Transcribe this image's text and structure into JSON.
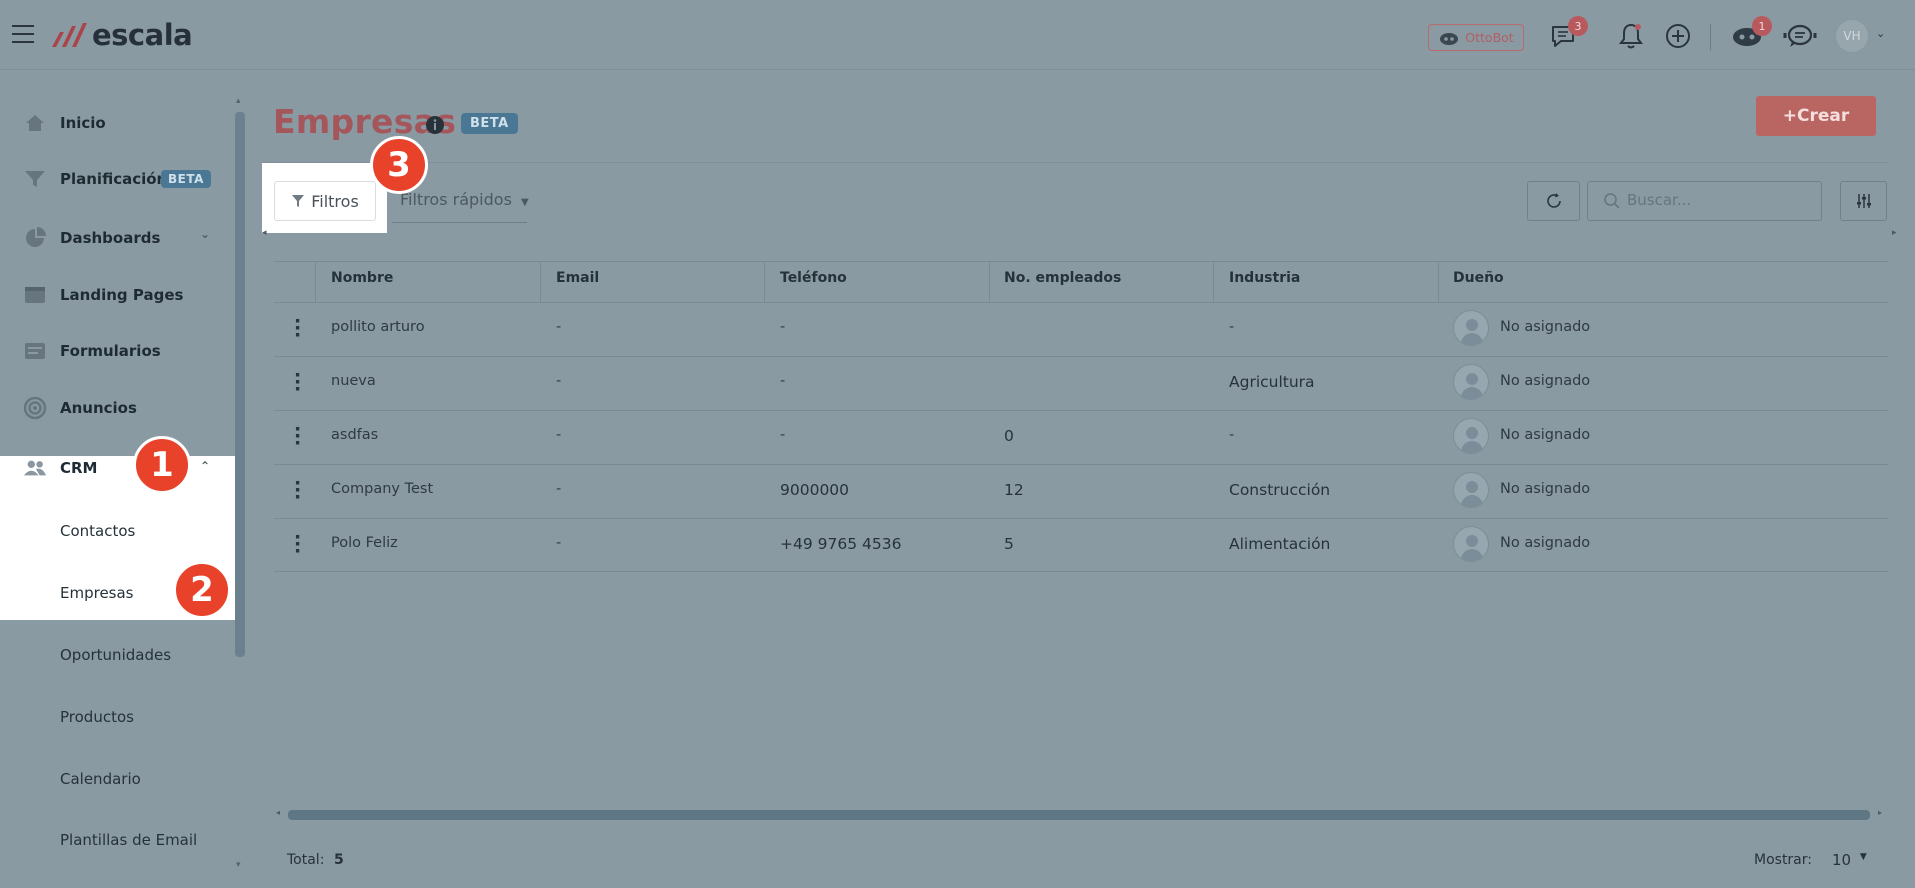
{
  "header": {
    "logo_text": "escala",
    "ottobot_label": "OttoBot",
    "messages_count": "3",
    "robot_count": "1",
    "avatar_initials": "VH"
  },
  "sidebar": {
    "items": [
      {
        "label": "Inicio",
        "icon": "home-icon"
      },
      {
        "label": "Planificación",
        "icon": "funnel-icon",
        "badge": "BETA"
      },
      {
        "label": "Dashboards",
        "icon": "pie-chart-icon"
      },
      {
        "label": "Landing Pages",
        "icon": "browser-icon"
      },
      {
        "label": "Formularios",
        "icon": "form-icon"
      },
      {
        "label": "Anuncios",
        "icon": "target-icon"
      },
      {
        "label": "CRM",
        "icon": "users-icon"
      }
    ],
    "crm_sub": [
      "Contactos",
      "Empresas",
      "Oportunidades",
      "Productos",
      "Calendario",
      "Plantillas de Email"
    ]
  },
  "markers": [
    "1",
    "2",
    "3"
  ],
  "page": {
    "title": "Empresas",
    "badge": "BETA",
    "create_label": "+Crear",
    "filters_label": "Filtros",
    "quick_filters_label": "Filtros rápidos",
    "search_placeholder": "Buscar..."
  },
  "table": {
    "columns": [
      "Nombre",
      "Email",
      "Teléfono",
      "No. empleados",
      "Industria",
      "Dueño"
    ],
    "rows": [
      {
        "nombre": "pollito arturo",
        "email": "-",
        "telefono": "-",
        "empleados": "",
        "industria": "-",
        "dueno": "No asignado"
      },
      {
        "nombre": "nueva",
        "email": "-",
        "telefono": "-",
        "empleados": "",
        "industria": "Agricultura",
        "dueno": "No asignado"
      },
      {
        "nombre": "asdfas",
        "email": "-",
        "telefono": "-",
        "empleados": "0",
        "industria": "-",
        "dueno": "No asignado"
      },
      {
        "nombre": "Company Test",
        "email": "-",
        "telefono": "9000000",
        "empleados": "12",
        "industria": "Construcción",
        "dueno": "No asignado"
      },
      {
        "nombre": "Polo Feliz",
        "email": "-",
        "telefono": "+49 9765 4536",
        "empleados": "5",
        "industria": "Alimentación",
        "dueno": "No asignado"
      }
    ]
  },
  "footer": {
    "total_label": "Total:",
    "total_value": "5",
    "show_label": "Mostrar:",
    "show_value": "10"
  }
}
